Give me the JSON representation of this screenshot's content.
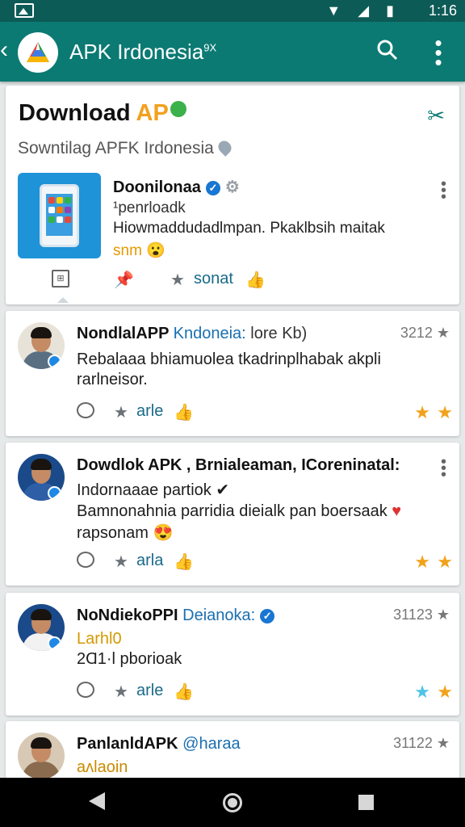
{
  "status_bar": {
    "time": "1:16",
    "icons": "▼ ◢ ▮"
  },
  "app_bar": {
    "title": "APK Irdonesia",
    "title_sup": "9X"
  },
  "hero": {
    "title_black": "Download ",
    "title_accent": "AP",
    "subtitle": "Sowntilag APFK Irdonesia",
    "app_name": "Doonilonaa",
    "app_line2": "¹penrloadk",
    "app_line3": "Hiowmaddudadlmpan. Pkaklbsih maitak",
    "app_line4": "snm",
    "action_label": "sonat"
  },
  "posts": [
    {
      "name": "NondlalAPP",
      "name_hl": "Kndoneia:",
      "name_rest": "lore Kb)",
      "meta": "3212 ★",
      "line1": "Rebalaaa bhiamuolea tkadrinplhabak akpli",
      "line2": "rarlneisor.",
      "action_label": "arle"
    },
    {
      "name": "Dowdlok APK , Brnialeaman, ICoreninatal:",
      "line1": "Indornaaae partiok",
      "line2": "Bamnonahnia parridia dieialk pan boersaak",
      "line3": "rapsonam",
      "action_label": "arla"
    },
    {
      "name": "NoNdiekoPPI",
      "name_hl": "Deianoka:",
      "meta": "31123 ★",
      "line1": "Larhl0",
      "line2": "2Ɑ1·l pborioak",
      "action_label": "arle"
    },
    {
      "name": "PanlanldAPK",
      "name_hl": "@haraa",
      "meta": "31122 ★",
      "line1": "aʌlaoin"
    }
  ],
  "colors": {
    "primary": "#0b7a73",
    "status_bar": "#0d5b56",
    "accent": "#f2a01d",
    "star": "#f1a21a"
  },
  "icons": [
    "gallery-icon",
    "wifi-icon",
    "signal-icon",
    "battery-icon",
    "back-icon",
    "app-logo-icon",
    "search-icon",
    "more-vert-icon",
    "share-icon",
    "location-pin-icon",
    "verified-icon",
    "gear-icon",
    "comment-icon",
    "star-icon",
    "thumb-icon"
  ]
}
